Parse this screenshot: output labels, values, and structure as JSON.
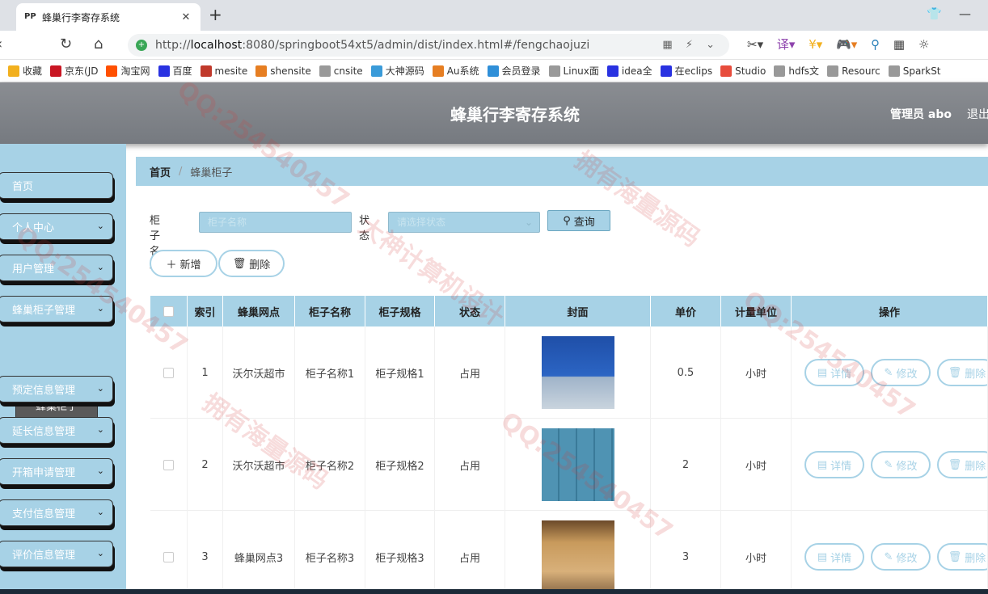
{
  "browser": {
    "tab_title": "蜂巢行李寄存系统",
    "url_prefix": "http://",
    "url_host": "localhost",
    "url_rest": ":8080/springboot54xt5/admin/dist/index.html#/fengchaojuzi",
    "bookmarks": [
      {
        "label": "收藏",
        "icon": "star-icon",
        "color": "#f2b01e"
      },
      {
        "label": "京东(JD",
        "icon": "jd-icon",
        "color": "#c91623"
      },
      {
        "label": "淘宝网",
        "icon": "taobao-icon",
        "color": "#ff5000"
      },
      {
        "label": "百度",
        "icon": "baidu-icon",
        "color": "#2932e1"
      },
      {
        "label": "mesite",
        "icon": "site-icon",
        "color": "#c0392b"
      },
      {
        "label": "shensite",
        "icon": "site-icon",
        "color": "#e67e22"
      },
      {
        "label": "cnsite",
        "icon": "page-icon",
        "color": "#999999"
      },
      {
        "label": "大神源码",
        "icon": "site-icon",
        "color": "#3a9bd9"
      },
      {
        "label": "Au系统",
        "icon": "site-icon",
        "color": "#e67e22"
      },
      {
        "label": "会员登录",
        "icon": "cloud-icon",
        "color": "#2f8fd8"
      },
      {
        "label": "Linux面",
        "icon": "page-icon",
        "color": "#999999"
      },
      {
        "label": "idea全",
        "icon": "baidu-icon",
        "color": "#2932e1"
      },
      {
        "label": "在eclips",
        "icon": "baidu-icon",
        "color": "#2932e1"
      },
      {
        "label": "Studio",
        "icon": "site-icon",
        "color": "#e74c3c"
      },
      {
        "label": "hdfs文",
        "icon": "page-icon",
        "color": "#999999"
      },
      {
        "label": "Resourc",
        "icon": "page-icon",
        "color": "#999999"
      },
      {
        "label": "SparkSt",
        "icon": "page-icon",
        "color": "#999999"
      }
    ]
  },
  "header": {
    "title": "蜂巢行李寄存系统",
    "user": "管理员 abo",
    "logout": "退出登录"
  },
  "sidebar": {
    "items": [
      {
        "label": "首页",
        "has_arrow": false
      },
      {
        "label": "个人中心",
        "has_arrow": true
      },
      {
        "label": "用户管理",
        "has_arrow": true
      },
      {
        "label": "蜂巢柜子管理",
        "has_arrow": true
      },
      {
        "label": "预定信息管理",
        "has_arrow": true
      },
      {
        "label": "延长信息管理",
        "has_arrow": true
      },
      {
        "label": "开箱申请管理",
        "has_arrow": true
      },
      {
        "label": "支付信息管理",
        "has_arrow": true
      },
      {
        "label": "评价信息管理",
        "has_arrow": true
      }
    ],
    "submenu_active": "蜂巢柜子"
  },
  "breadcrumb": {
    "home": "首页",
    "current": "蜂巢柜子"
  },
  "search": {
    "name_label": "柜子名称",
    "name_placeholder": "柜子名称",
    "status_label": "状态",
    "status_placeholder": "请选择状态",
    "query_button": "查询"
  },
  "actions": {
    "add": "新增",
    "delete": "删除"
  },
  "table": {
    "columns": [
      "索引",
      "蜂巢网点",
      "柜子名称",
      "柜子规格",
      "状态",
      "封面",
      "单价",
      "计量单位",
      "操作"
    ],
    "rows": [
      {
        "index": "1",
        "site": "沃尔沃超市",
        "name": "柜子名称1",
        "spec": "柜子规格1",
        "status": "占用",
        "price": "0.5",
        "unit": "小时",
        "cover": "blue-lockers"
      },
      {
        "index": "2",
        "site": "沃尔沃超市",
        "name": "柜子名称2",
        "spec": "柜子规格2",
        "status": "占用",
        "price": "2",
        "unit": "小时",
        "cover": "teal-lockers"
      },
      {
        "index": "3",
        "site": "蜂巢网点3",
        "name": "柜子名称3",
        "spec": "柜子规格3",
        "status": "占用",
        "price": "3",
        "unit": "小时",
        "cover": "wood-lockers"
      }
    ],
    "op_labels": {
      "detail": "详情",
      "edit": "修改",
      "delete": "删除"
    }
  },
  "colors": {
    "accent": "#a7d2e6",
    "header": "#7f8388",
    "watermark": "#d23c3c"
  }
}
